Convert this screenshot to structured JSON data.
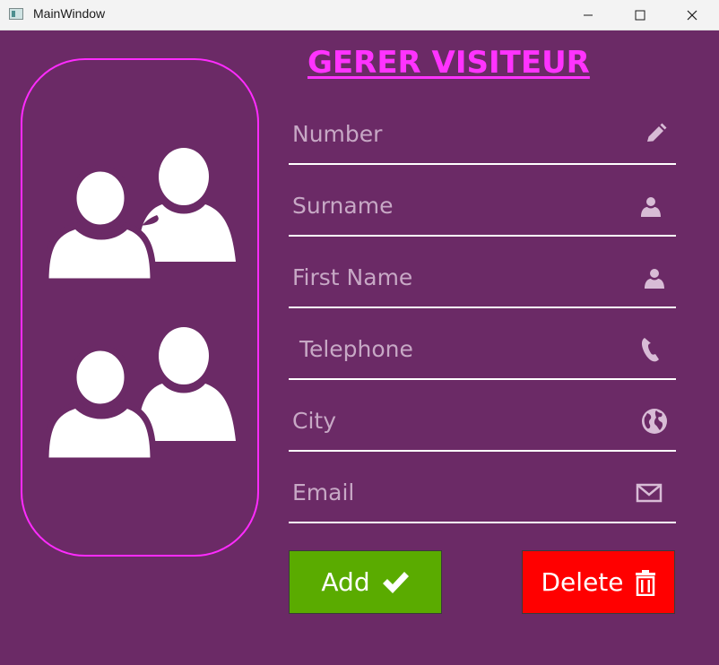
{
  "window": {
    "title": "MainWindow",
    "controls": [
      "minimize-icon",
      "maximize-icon",
      "close-icon"
    ]
  },
  "page": {
    "title": "GERER VISITEUR"
  },
  "form": {
    "fields": [
      {
        "placeholder": "Number",
        "icon": "pencil-icon"
      },
      {
        "placeholder": "Surname",
        "icon": "user-icon"
      },
      {
        "placeholder": "First Name",
        "icon": "user-icon"
      },
      {
        "placeholder": " Telephone",
        "icon": "phone-icon"
      },
      {
        "placeholder": "City",
        "icon": "globe-icon"
      },
      {
        "placeholder": "Email",
        "icon": "envelope-icon"
      }
    ]
  },
  "buttons": {
    "add_label": "Add",
    "add_icon": "checkmark-icon",
    "delete_label": "Delete",
    "delete_icon": "trash-icon"
  },
  "colors": {
    "background": "#6b2a66",
    "title": "#ff33ff",
    "frame_border": "#ff2bff",
    "add_button": "#5aab00",
    "delete_button": "#ff0000",
    "field_line": "#ffffff",
    "placeholder": "#c7a8c5"
  }
}
